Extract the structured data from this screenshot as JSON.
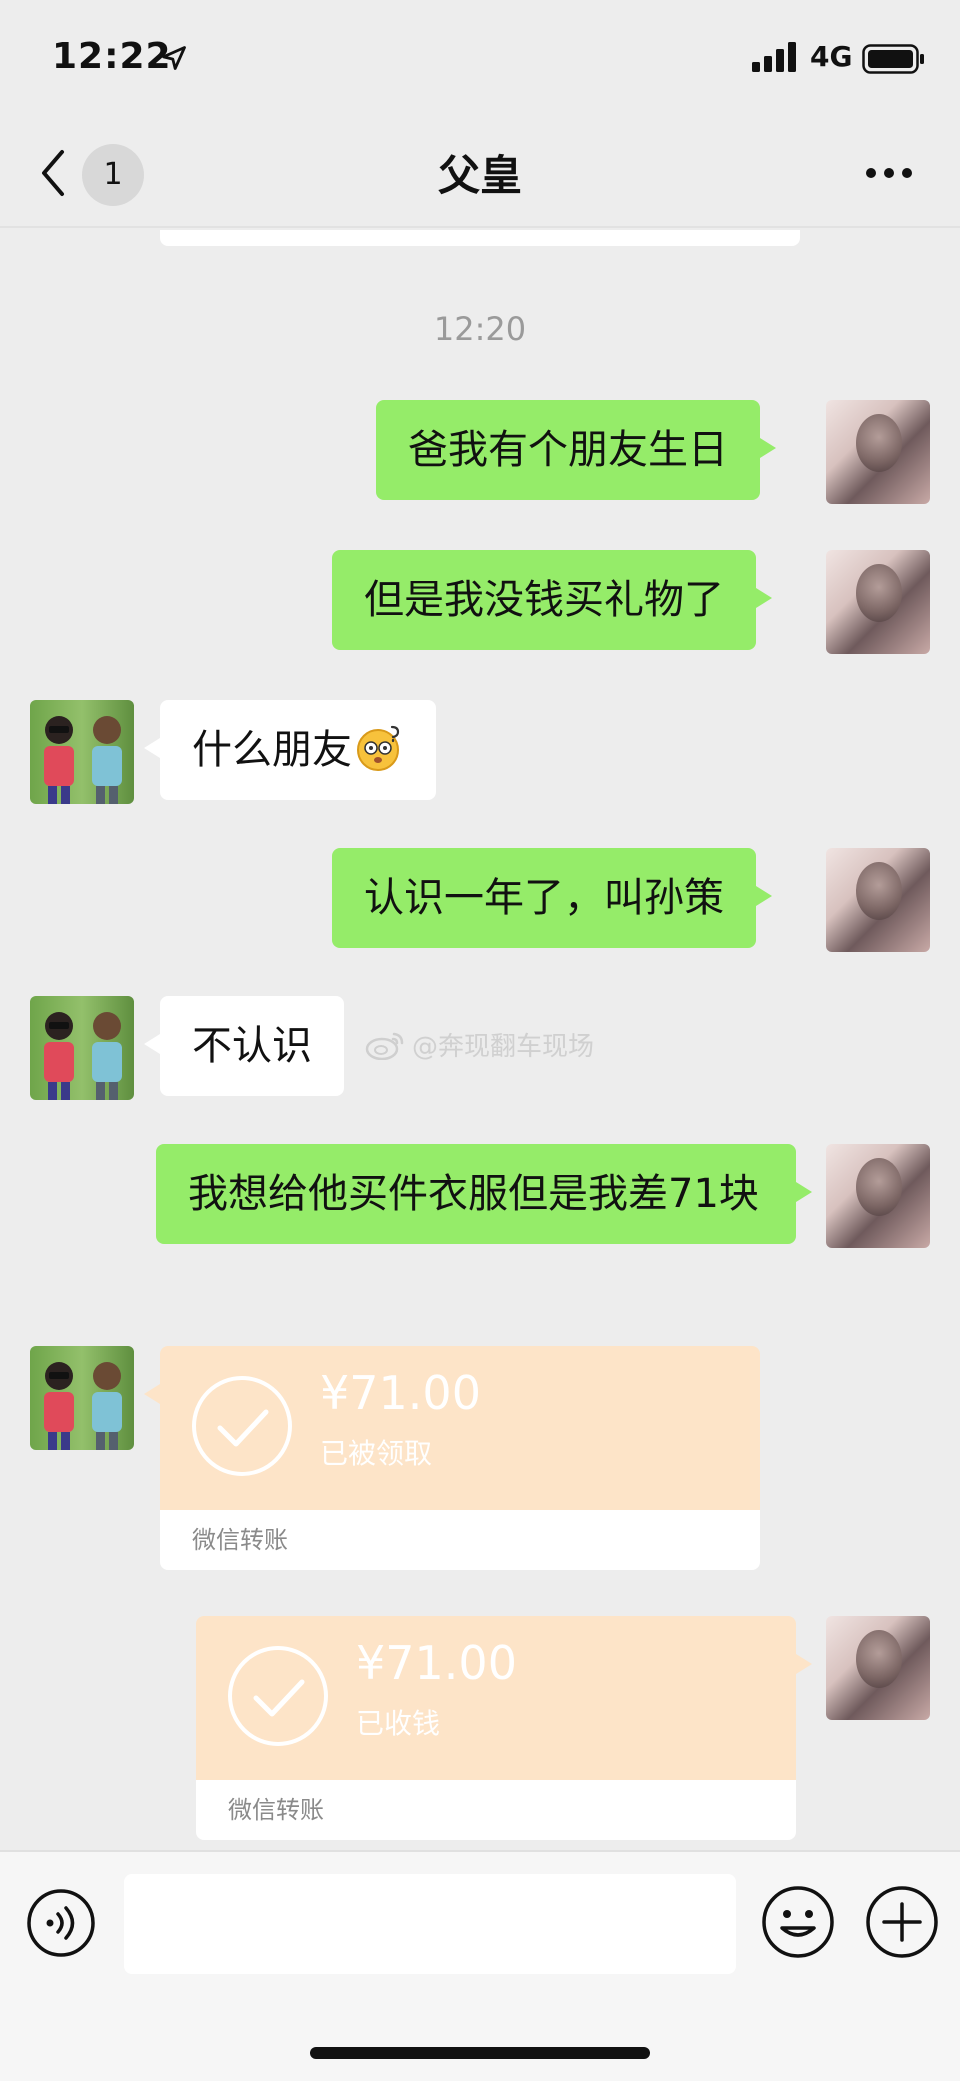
{
  "status_bar": {
    "time": "12:22",
    "network": "4G"
  },
  "nav": {
    "unread_count": "1",
    "title": "父皇"
  },
  "chat": {
    "timestamp": "12:20",
    "messages": [
      {
        "text": "爸我有个朋友生日"
      },
      {
        "text": "但是我没钱买礼物了"
      },
      {
        "text": "什么朋友"
      },
      {
        "text": "认识一年了，叫孙策"
      },
      {
        "text": "不认识"
      },
      {
        "text": "我想给他买件衣服但是我差71块"
      }
    ],
    "transfers": [
      {
        "amount": "¥71.00",
        "status": "已被领取",
        "label": "微信转账"
      },
      {
        "amount": "¥71.00",
        "status": "已收钱",
        "label": "微信转账"
      }
    ],
    "watermark": "@奔现翻车现场"
  },
  "input": {
    "value": ""
  },
  "colors": {
    "self_bubble": "#95ec69",
    "transfer": "#fde4c8",
    "background": "#ededed"
  },
  "icons": [
    "location-arrow-icon",
    "signal-icon",
    "battery-icon",
    "back-chevron-icon",
    "more-icon",
    "dizzy-emoji-icon",
    "weibo-icon",
    "check-circle-icon",
    "voice-icon",
    "emoji-icon",
    "plus-icon"
  ]
}
